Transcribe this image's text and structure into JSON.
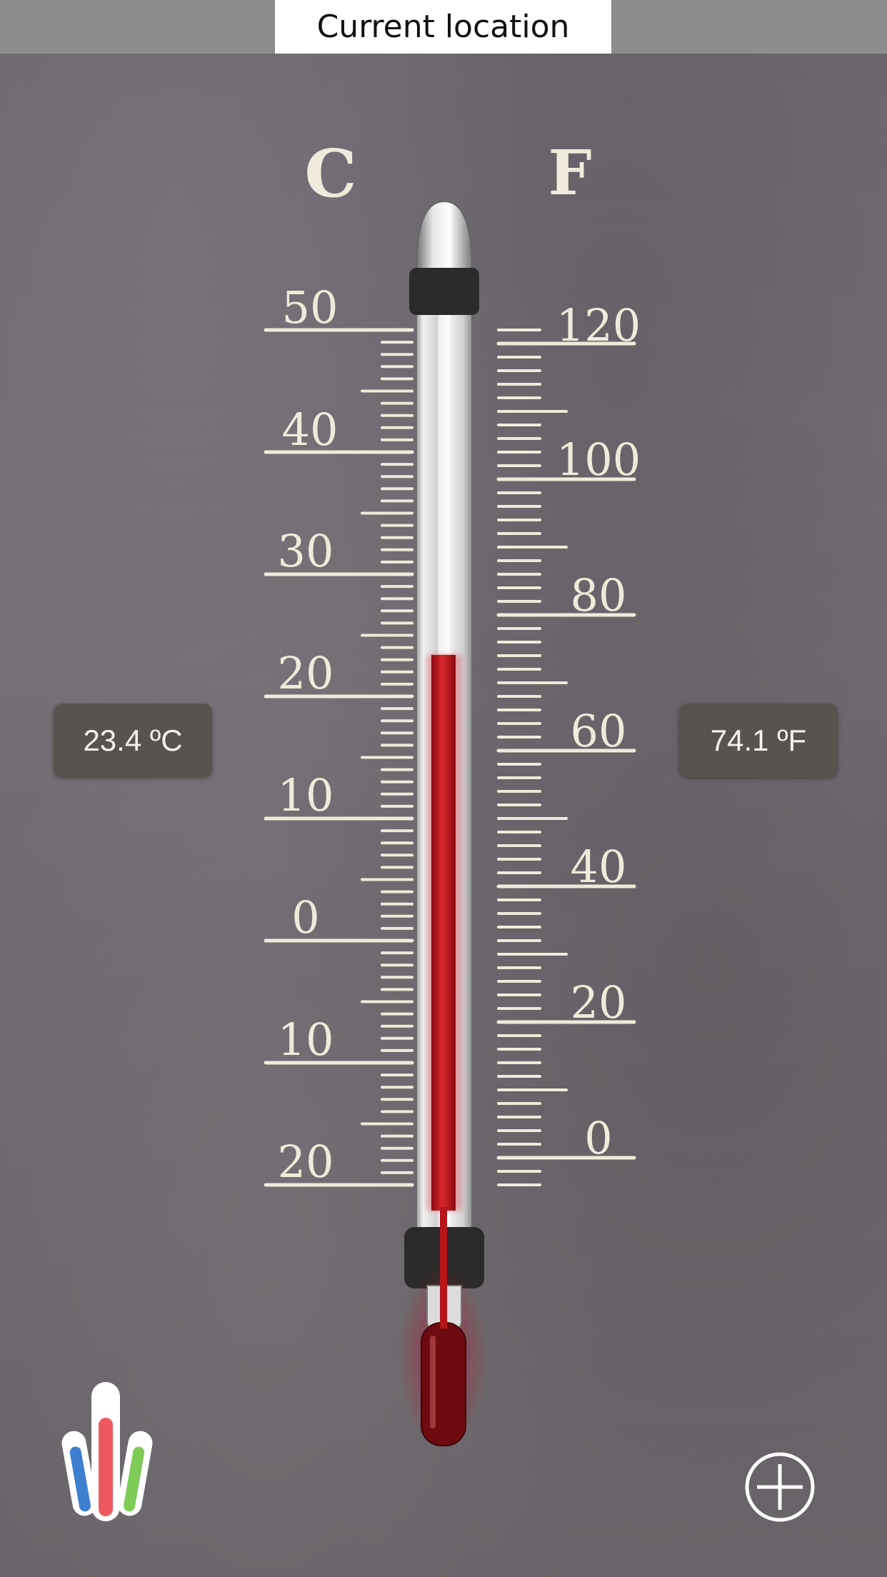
{
  "header": {
    "location_label": "Current location"
  },
  "scale": {
    "celsius_unit": "C",
    "fahrenheit_unit": "F",
    "celsius_labels": [
      "50",
      "40",
      "30",
      "20",
      "10",
      "0",
      "10",
      "20"
    ],
    "fahrenheit_labels": [
      "120",
      "100",
      "80",
      "60",
      "40",
      "20",
      "0"
    ]
  },
  "readings": {
    "celsius_text": "23.4 ºC",
    "fahrenheit_text": "74.1 ºF",
    "celsius_value": 23.4
  },
  "icons": {
    "logo": "thermometer-logo-icon",
    "add": "plus-circle-icon"
  },
  "colors": {
    "mercury": "#c8161e",
    "scale_ink": "#efeadb",
    "readout_bg": "#59534f"
  }
}
